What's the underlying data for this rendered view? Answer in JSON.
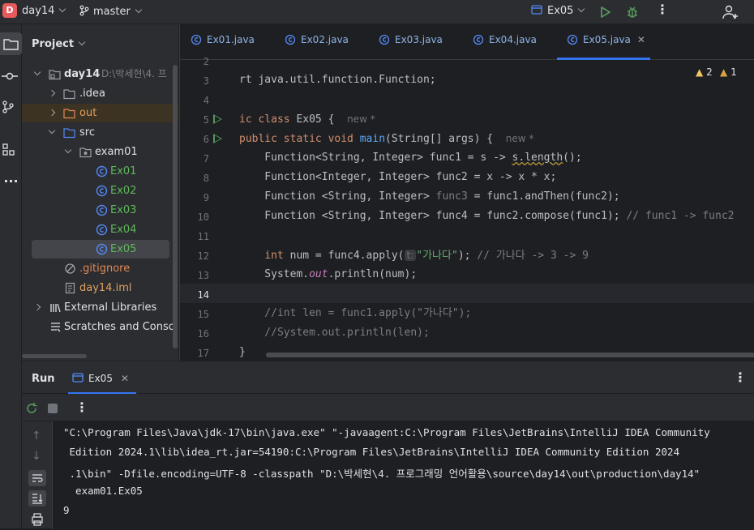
{
  "topbar": {
    "project_badge": "D",
    "project_name": "day14",
    "branch": "master",
    "run_config": "Ex05"
  },
  "project_panel": {
    "title": "Project",
    "tree": [
      {
        "label": "day14",
        "suffix": "D:\\박세현\\4. 프",
        "icon": "folder-icon",
        "level": 0,
        "expanded": true
      },
      {
        "label": ".idea",
        "icon": "folder-icon",
        "level": 1,
        "expanded": false
      },
      {
        "label": "out",
        "icon": "folder-orange-icon",
        "level": 1,
        "expanded": false
      },
      {
        "label": "src",
        "icon": "folder-blue-icon",
        "level": 1,
        "expanded": true
      },
      {
        "label": "exam01",
        "icon": "package-icon",
        "level": 2,
        "expanded": true
      },
      {
        "label": "Ex01",
        "icon": "java-class-icon",
        "level": 3
      },
      {
        "label": "Ex02",
        "icon": "java-class-icon",
        "level": 3
      },
      {
        "label": "Ex03",
        "icon": "java-class-icon",
        "level": 3
      },
      {
        "label": "Ex04",
        "icon": "java-class-icon",
        "level": 3
      },
      {
        "label": "Ex05",
        "icon": "java-class-icon",
        "level": 3,
        "selected": true
      },
      {
        "label": ".gitignore",
        "icon": "file-icon",
        "level": 2
      },
      {
        "label": "day14.iml",
        "icon": "file-icon",
        "level": 2
      },
      {
        "label": "External Libraries",
        "icon": "library-icon",
        "level": 0
      },
      {
        "label": "Scratches and Consoles",
        "icon": "scratches-icon",
        "level": 0
      }
    ]
  },
  "editor": {
    "tabs": [
      "Ex01.java",
      "Ex02.java",
      "Ex03.java",
      "Ex04.java",
      "Ex05.java"
    ],
    "active_tab": "Ex05.java",
    "warnings": "2",
    "weak_warnings": "1",
    "line_numbers": [
      "2",
      "3",
      "4",
      "5",
      "6",
      "7",
      "8",
      "9",
      "10",
      "11",
      "12",
      "13",
      "14",
      "15",
      "16",
      "17"
    ],
    "hint_new": "new *",
    "inlay_t": "t:"
  },
  "run_panel": {
    "title": "Run",
    "tab": "Ex05",
    "console": [
      "\"C:\\Program Files\\Java\\jdk-17\\bin\\java.exe\" \"-javaagent:C:\\Program Files\\JetBrains\\IntelliJ IDEA Community",
      " Edition 2024.1\\lib\\idea_rt.jar=54190:C:\\Program Files\\JetBrains\\IntelliJ IDEA Community Edition 2024",
      " .1\\bin\" -Dfile.encoding=UTF-8 -classpath \"D:\\박세현\\4. 프로그래밍 언어활용\\source\\day14\\out\\production\\day14\"",
      "  exam01.Ex05",
      "9"
    ]
  }
}
